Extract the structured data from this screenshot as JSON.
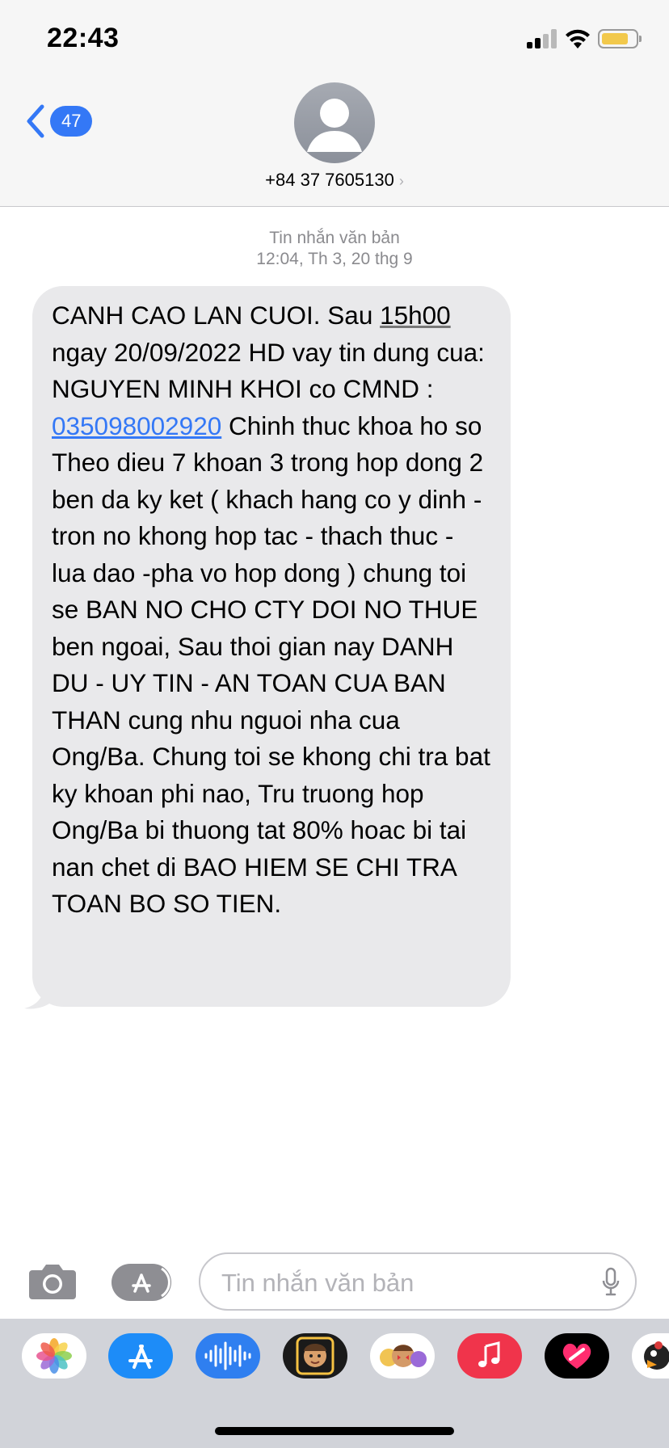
{
  "status_bar": {
    "time": "22:43"
  },
  "header": {
    "back_count": "47",
    "contact": "+84 37 7605130",
    "contact_chevron": "›"
  },
  "thread": {
    "message_type": "Tin nhắn văn bản",
    "timestamp": "12:04, Th 3, 20 thg 9",
    "message": {
      "part1": "CANH CAO LAN CUOI. Sau ",
      "time_link": "15h00",
      "part2": " ngay 20/09/2022 HD vay tin dung cua: NGUYEN MINH KHOI co CMND : ",
      "id_link": "035098002920",
      "part3": " Chinh thuc khoa ho so Theo dieu 7 khoan 3 trong hop dong 2 ben da ky ket ( khach hang co y dinh - tron no khong hop tac - thach thuc - lua dao -pha vo hop dong ) chung toi se BAN NO CHO CTY DOI NO THUE ben ngoai, Sau thoi gian nay DANH DU - UY TIN - AN TOAN CUA BAN THAN cung nhu nguoi nha cua Ong/Ba. Chung toi se khong chi tra bat ky khoan phi nao, Tru truong hop Ong/Ba bi thuong tat 80% hoac bi tai nan chet di BAO HIEM SE CHI TRA TOAN BO SO TIEN."
    }
  },
  "composer": {
    "placeholder": "Tin nhắn văn bản"
  },
  "app_tray": {
    "apps": [
      "photos-icon",
      "app-store-icon",
      "audio-message-icon",
      "memoji-icon",
      "animoji-stickers-icon",
      "music-icon",
      "digital-touch-icon",
      "more-app-icon"
    ]
  },
  "colors": {
    "accent": "#3478f6",
    "bubble_gray": "#e9e9eb",
    "header_bg": "#f6f6f6",
    "tray_bg": "#d1d3d9"
  }
}
